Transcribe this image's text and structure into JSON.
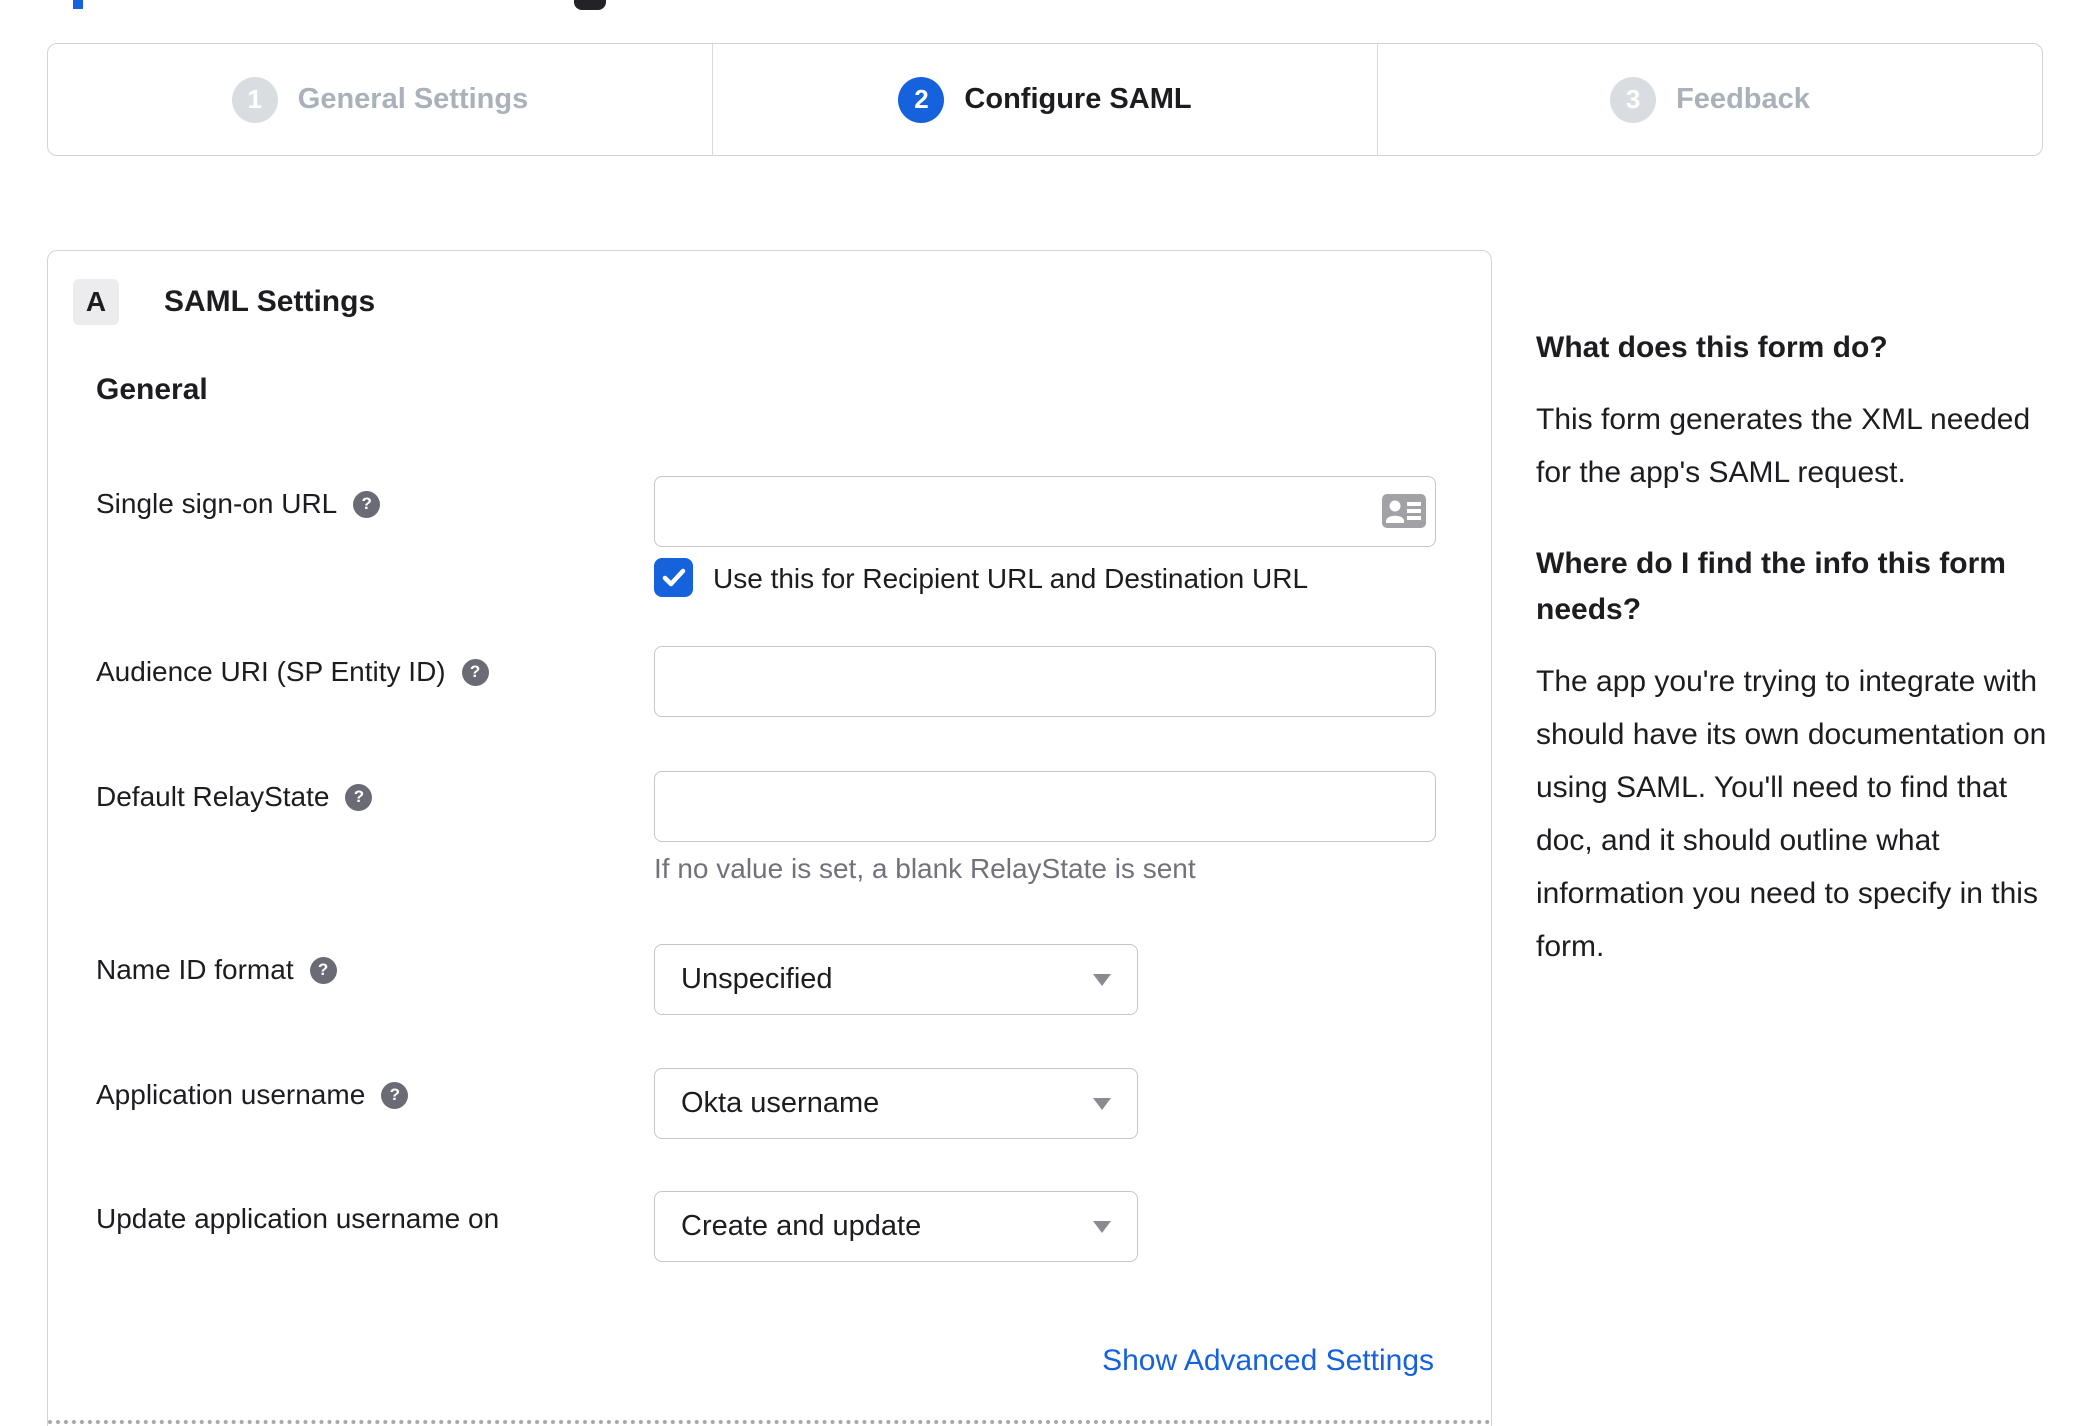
{
  "stepper": {
    "steps": [
      {
        "number": "1",
        "label": "General Settings",
        "active": false
      },
      {
        "number": "2",
        "label": "Configure SAML",
        "active": true
      },
      {
        "number": "3",
        "label": "Feedback",
        "active": false
      }
    ]
  },
  "form": {
    "section_badge": "A",
    "section_title": "SAML Settings",
    "group_title": "General",
    "sso_label": "Single sign-on URL",
    "sso_value": "",
    "sso_checkbox_label": "Use this for Recipient URL and Destination URL",
    "sso_checkbox_checked": true,
    "audience_label": "Audience URI (SP Entity ID)",
    "audience_value": "",
    "relay_label": "Default RelayState",
    "relay_value": "",
    "relay_hint": "If no value is set, a blank RelayState is sent",
    "name_id_label": "Name ID format",
    "name_id_value": "Unspecified",
    "app_username_label": "Application username",
    "app_username_value": "Okta username",
    "update_username_label": "Update application username on",
    "update_username_value": "Create and update",
    "advanced_link": "Show Advanced Settings"
  },
  "help_panel": {
    "q1_heading": "What does this form do?",
    "q1_body": "This form generates the XML needed\nfor the app's SAML request.",
    "q2_heading": "Where do I find the info this form\nneeds?",
    "q2_body": "The app you're trying to integrate with\nshould have its own documentation on\nusing SAML. You'll need to find that\ndoc, and it should outline what\ninformation you need to specify in this\nform."
  },
  "icons": {
    "help_glyph": "?"
  },
  "colors": {
    "accent_blue": "#1662dd",
    "inactive_gray": "#a9b1ba",
    "text": "#1d1d21",
    "border": "#d4d4d8"
  }
}
